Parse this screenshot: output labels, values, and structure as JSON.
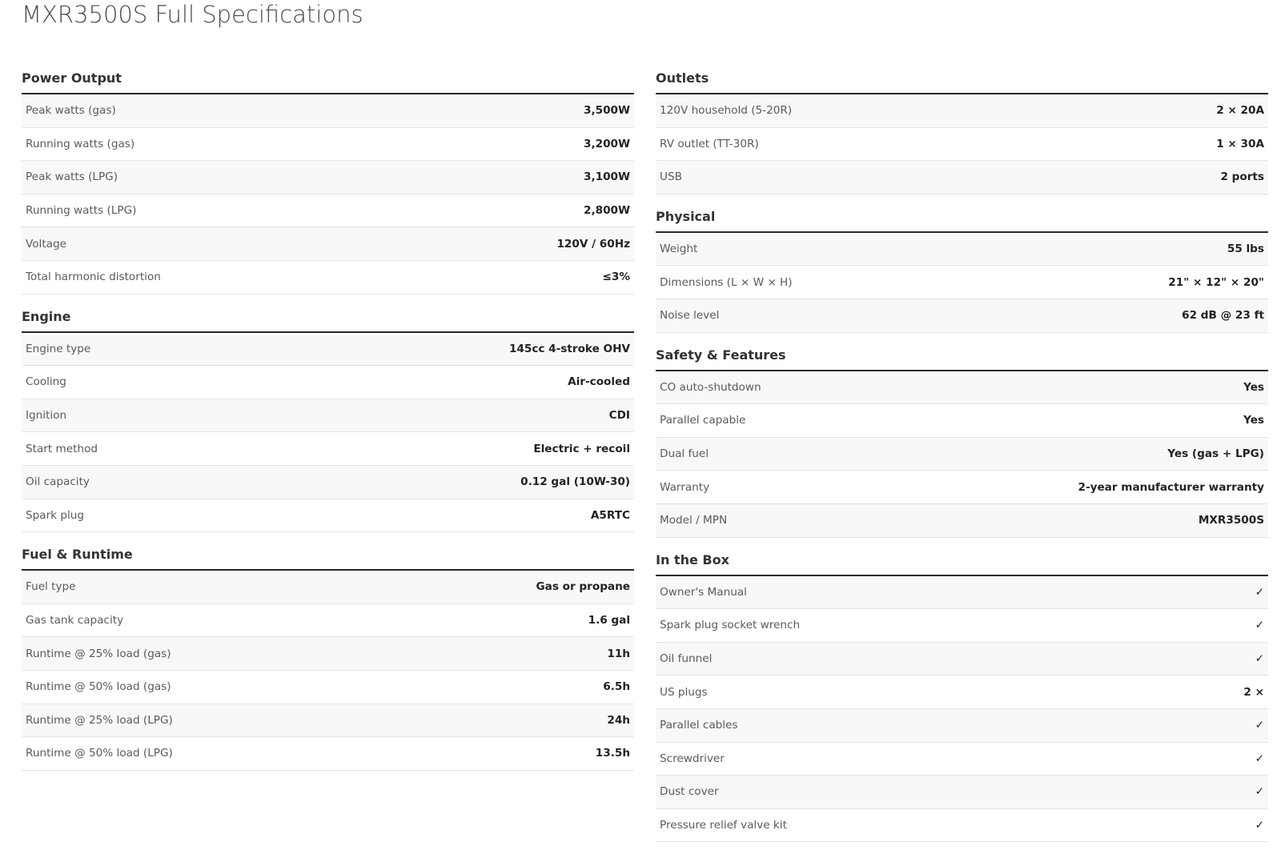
{
  "page": {
    "title": "MXR3500S Full Specifications"
  },
  "left_column": [
    {
      "title": "Power Output",
      "rows": [
        {
          "label": "Peak watts (gas)",
          "value": "3,500W"
        },
        {
          "label": "Running watts (gas)",
          "value": "3,200W"
        },
        {
          "label": "Peak watts (LPG)",
          "value": "3,100W"
        },
        {
          "label": "Running watts (LPG)",
          "value": "2,800W"
        },
        {
          "label": "Voltage",
          "value": "120V / 60Hz"
        },
        {
          "label": "Total harmonic distortion",
          "value": "≤3%"
        }
      ]
    },
    {
      "title": "Engine",
      "rows": [
        {
          "label": "Engine type",
          "value": "145cc 4-stroke OHV"
        },
        {
          "label": "Cooling",
          "value": "Air-cooled"
        },
        {
          "label": "Ignition",
          "value": "CDI"
        },
        {
          "label": "Start method",
          "value": "Electric + recoil"
        },
        {
          "label": "Oil capacity",
          "value": "0.12 gal (10W-30)"
        },
        {
          "label": "Spark plug",
          "value": "A5RTC"
        }
      ]
    },
    {
      "title": "Fuel & Runtime",
      "rows": [
        {
          "label": "Fuel type",
          "value": "Gas or propane"
        },
        {
          "label": "Gas tank capacity",
          "value": "1.6 gal"
        },
        {
          "label": "Runtime @ 25% load (gas)",
          "value": "11h"
        },
        {
          "label": "Runtime @ 50% load (gas)",
          "value": "6.5h"
        },
        {
          "label": "Runtime @ 25% load (LPG)",
          "value": "24h"
        },
        {
          "label": "Runtime @ 50% load (LPG)",
          "value": "13.5h"
        }
      ]
    }
  ],
  "right_column": [
    {
      "title": "Outlets",
      "rows": [
        {
          "label": "120V household (5-20R)",
          "value": "2 × 20A"
        },
        {
          "label": "RV outlet (TT-30R)",
          "value": "1 × 30A"
        },
        {
          "label": "USB",
          "value": "2 ports"
        }
      ]
    },
    {
      "title": "Physical",
      "rows": [
        {
          "label": "Weight",
          "value": "55 lbs"
        },
        {
          "label": "Dimensions (L × W × H)",
          "value": "21\" × 12\" × 20\""
        },
        {
          "label": "Noise level",
          "value": "62 dB @ 23 ft"
        }
      ]
    },
    {
      "title": "Safety & Features",
      "rows": [
        {
          "label": "CO auto-shutdown",
          "value": "Yes"
        },
        {
          "label": "Parallel capable",
          "value": "Yes"
        },
        {
          "label": "Dual fuel",
          "value": "Yes (gas + LPG)"
        },
        {
          "label": "Warranty",
          "value": "2-year manufacturer warranty"
        },
        {
          "label": "Model / MPN",
          "value": "MXR3500S"
        }
      ]
    },
    {
      "title": "In the Box",
      "rows": [
        {
          "label": "Owner's Manual",
          "value": "✓"
        },
        {
          "label": "Spark plug socket wrench",
          "value": "✓"
        },
        {
          "label": "Oil funnel",
          "value": "✓"
        },
        {
          "label": "US plugs",
          "value": "2 ×"
        },
        {
          "label": "Parallel cables",
          "value": "✓"
        },
        {
          "label": "Screwdriver",
          "value": "✓"
        },
        {
          "label": "Dust cover",
          "value": "✓"
        },
        {
          "label": "Pressure relief valve kit",
          "value": "✓"
        }
      ]
    }
  ]
}
